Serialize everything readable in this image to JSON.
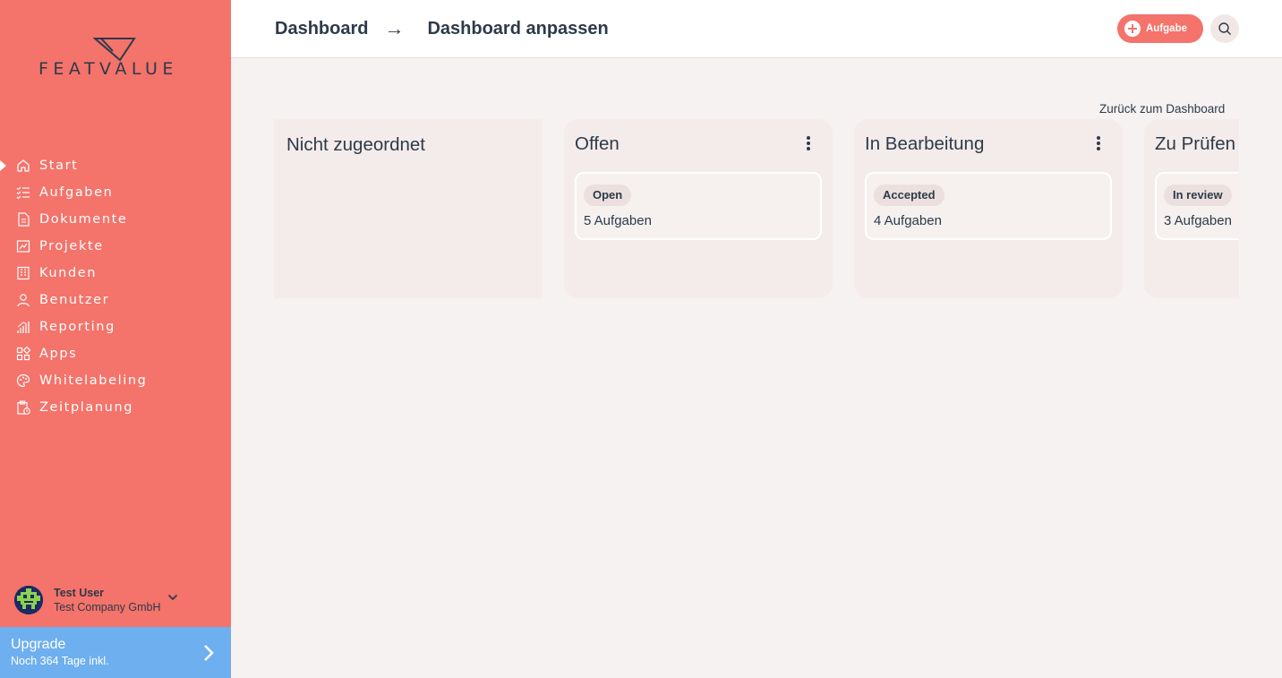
{
  "brand": {
    "logo_text": "FEATVALUE"
  },
  "sidebar": {
    "items": [
      {
        "label": "Start",
        "icon": "home-icon",
        "active": true
      },
      {
        "label": "Aufgaben",
        "icon": "checklist-icon",
        "active": false
      },
      {
        "label": "Dokumente",
        "icon": "document-icon",
        "active": false
      },
      {
        "label": "Projekte",
        "icon": "chart-icon",
        "active": false
      },
      {
        "label": "Kunden",
        "icon": "building-icon",
        "active": false
      },
      {
        "label": "Benutzer",
        "icon": "user-icon",
        "active": false
      },
      {
        "label": "Reporting",
        "icon": "bar-chart-icon",
        "active": false
      },
      {
        "label": "Apps",
        "icon": "apps-icon",
        "active": false
      },
      {
        "label": "Whitelabeling",
        "icon": "palette-icon",
        "active": false
      },
      {
        "label": "Zeitplanung",
        "icon": "clipboard-clock-icon",
        "active": false
      }
    ],
    "user": {
      "name": "Test User",
      "company": "Test Company GmbH"
    },
    "upgrade": {
      "title": "Upgrade",
      "subtitle": "Noch 364 Tage inkl."
    }
  },
  "header": {
    "breadcrumb": [
      "Dashboard",
      "Dashboard anpassen"
    ],
    "breadcrumb_separator": "→",
    "add_task_label": "Aufgabe"
  },
  "main": {
    "back_link": "Zurück zum Dashboard",
    "columns": [
      {
        "title": "Nicht zugeordnet",
        "cards": []
      },
      {
        "title": "Offen",
        "cards": [
          {
            "badge": "Open",
            "count_text": "5 Aufgaben"
          }
        ]
      },
      {
        "title": "In Bearbeitung",
        "cards": [
          {
            "badge": "Accepted",
            "count_text": "4 Aufgaben"
          }
        ]
      },
      {
        "title": "Zu Prüfen",
        "cards": [
          {
            "badge": "In review",
            "count_text": "3 Aufgaben"
          }
        ]
      }
    ]
  },
  "colors": {
    "sidebar_bg": "#f4736a",
    "upgrade_bg": "#6eaff0",
    "text_dark": "#2d3a4a",
    "page_bg": "#f6f2f1",
    "column_bg": "#f4ecea"
  }
}
